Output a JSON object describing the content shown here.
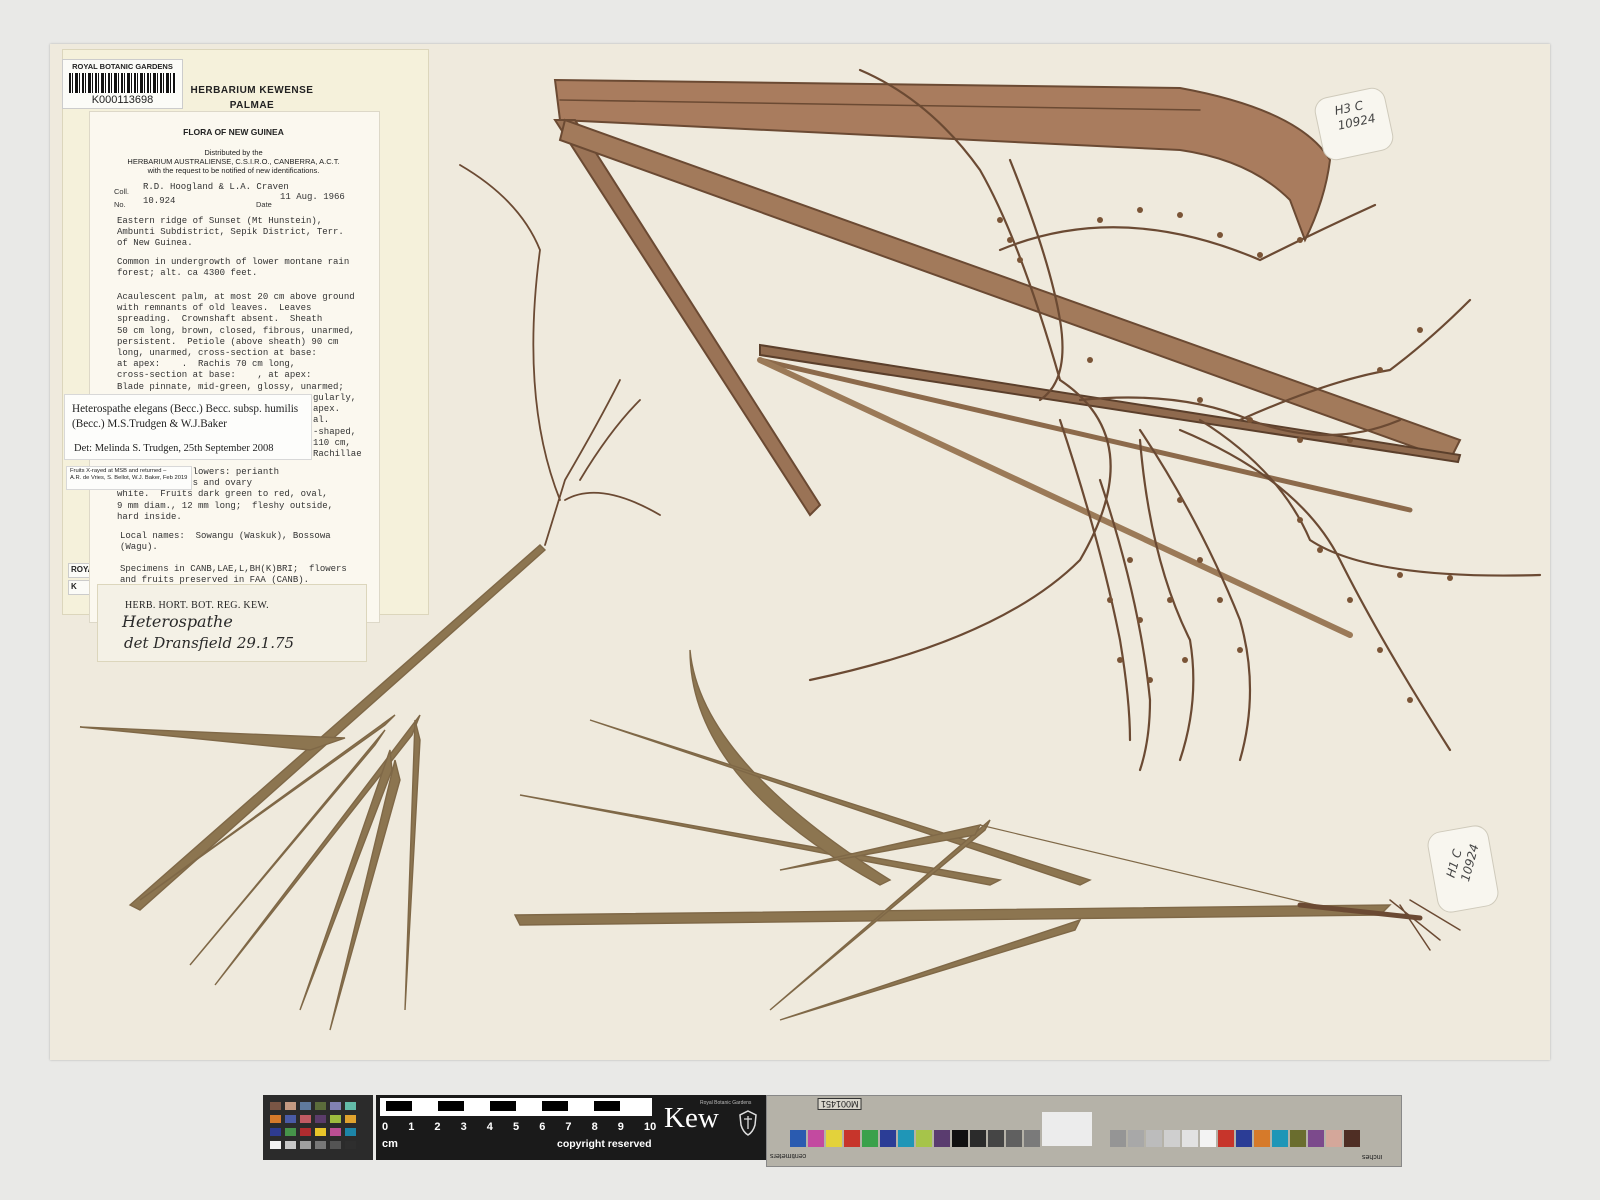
{
  "barcode": {
    "title": "ROYAL BOTANIC GARDENS KEW",
    "number": "K000113698"
  },
  "kew_label": {
    "line1": "HERBARIUM KEWENSE",
    "line2": "PALMAE",
    "stub1": "ROYAL",
    "stub2": "K"
  },
  "flora_label": {
    "heading": "FLORA OF NEW GUINEA",
    "distributed1": "Distributed by the",
    "distributed2": "HERBARIUM AUSTRALIENSE, C.S.I.R.O., CANBERRA, A.C.T.",
    "distributed3": "with the request to be notified of new identifications.",
    "coll_label": "Coll.",
    "collectors": "R.D. Hoogland & L.A. Craven",
    "no_label": "No.",
    "number": "10.924",
    "date_label": "Date",
    "date": "11 Aug. 1966",
    "locality": "Eastern ridge of Sunset (Mt Hunstein),\nAmbunti Subdistrict, Sepik District, Terr.\nof New Guinea.",
    "habitat": "Common in undergrowth of lower montane rain\nforest; alt. ca 4300 feet.",
    "description": "Acaulescent palm, at most 20 cm above ground\nwith remnants of old leaves.  Leaves\nspreading.  Crownshaft absent.  Sheath\n50 cm long, brown, closed, fibrous, unarmed,\npersistent.  Petiole (above sheath) 90 cm\nlong, unarmed, cross-section at base:\nat apex:    .  Rachis 70 cm long,\ncross-section at base:    , at apex:\nBlade pinnate, mid-green, glossy, unarmed;",
    "desc_right": "gularly,\napex.\nal.\n-shaped,\n110 cm,\nRachillae",
    "desc_cont": "olivaceous.  Flowers: perianth\nbrown;  stamens and ovary\nwhite.  Fruits dark green to red, oval,\n9 mm diam., 12 mm long;  fleshy outside,\nhard inside.",
    "local_names": "Local names:  Sowangu (Waskuk), Bossowa\n(Wagu).",
    "specimens": "Specimens in CANB,LAE,L,BH(K)BRI;  flowers\nand fruits preserved in FAA (CANB)."
  },
  "determination": {
    "name_line1": "Heterospathe elegans (Becc.) Becc. subsp. humilis",
    "name_line2": "(Becc.) M.S.Trudgen & W.J.Baker",
    "det": "Det: Melinda S. Trudgen, 25th September 2008"
  },
  "xray_note": {
    "line1": "Fruits X-rayed at MSB and returned –",
    "line2": "A.R. de Vries, S. Bellot, W.J. Baker, Feb 2019"
  },
  "herb_slip": {
    "title": "HERB. HORT. BOT. REG. KEW.",
    "hand1": "Heterospathe",
    "hand2": "det Dransfield 29.1.75"
  },
  "tags": {
    "tag1_line1": "H3 C",
    "tag1_line2": "10924",
    "tag2_line1": "H1 C",
    "tag2_line2": "10924"
  },
  "scale": {
    "numbers": [
      "0",
      "1",
      "2",
      "3",
      "4",
      "5",
      "6",
      "7",
      "8",
      "9",
      "10"
    ],
    "unit": "cm",
    "copyright": "copyright reserved",
    "logo": "Kew",
    "logo_sub": "Royal Botanic Gardens"
  },
  "density_card": {
    "id": "M001451",
    "cm_label": "centimeters",
    "in_label": "inches"
  },
  "colors": {
    "paper": "#efeadd",
    "leaf": "#8a6d45",
    "stem": "#7c5a3e",
    "label": "#f5f1db"
  }
}
